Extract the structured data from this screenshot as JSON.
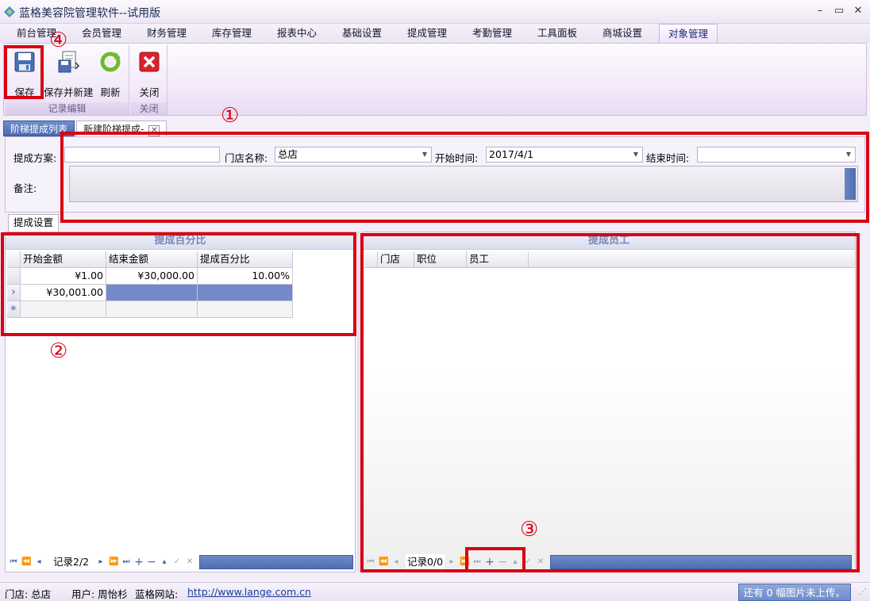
{
  "window": {
    "title": "蓝格美容院管理软件--试用版",
    "min": "–",
    "max": "▭",
    "close": "✕"
  },
  "menu": {
    "items": [
      "前台管理",
      "会员管理",
      "财务管理",
      "库存管理",
      "报表中心",
      "基础设置",
      "提成管理",
      "考勤管理",
      "工具面板",
      "商城设置",
      "对象管理"
    ],
    "active": "对象管理"
  },
  "ribbon": {
    "groups": [
      {
        "caption": "记录编辑",
        "buttons": [
          "保存",
          "保存并新建",
          "刷新"
        ]
      },
      {
        "caption": "关闭",
        "buttons": [
          "关闭"
        ]
      }
    ]
  },
  "doc_tabs": [
    {
      "label": "阶梯提成列表",
      "selected": true
    },
    {
      "label": "新建阶梯提成-",
      "selected": false
    }
  ],
  "form": {
    "plan_label": "提成方案:",
    "plan_value": "",
    "store_label": "门店名称:",
    "store_value": "总店",
    "start_label": "开始时间:",
    "start_value": "2017/4/1",
    "end_label": "结束时间:",
    "end_value": "",
    "remark_label": "备注:"
  },
  "settings_tab": "提成设置",
  "left_grid": {
    "title": "提成百分比",
    "columns": [
      "开始金额",
      "结束金额",
      "提成百分比"
    ],
    "rows": [
      {
        "indicator": "",
        "cells": [
          "¥1.00",
          "¥30,000.00",
          "10.00%"
        ]
      },
      {
        "indicator": "›",
        "cells": [
          "¥30,001.00",
          "",
          ""
        ]
      },
      {
        "indicator": "✳",
        "cells": [
          "",
          "",
          ""
        ]
      }
    ],
    "nav_text": "记录2/2"
  },
  "right_grid": {
    "title": "提成员工",
    "columns": [
      "门店",
      "职位",
      "员工"
    ],
    "nav_text": "记录0/0"
  },
  "statusbar": {
    "store": "门店: 总店",
    "user": "用户: 周怡杉",
    "site_label": "蓝格网站:",
    "site_url": "http://www.lange.com.cn",
    "upload": "还有 0 幅图片未上传。"
  },
  "annotations": [
    "①",
    "②",
    "③",
    "④"
  ],
  "colors": {
    "accent": "#4a68b0",
    "highlight": "#d90012",
    "selection": "#7389c8"
  }
}
